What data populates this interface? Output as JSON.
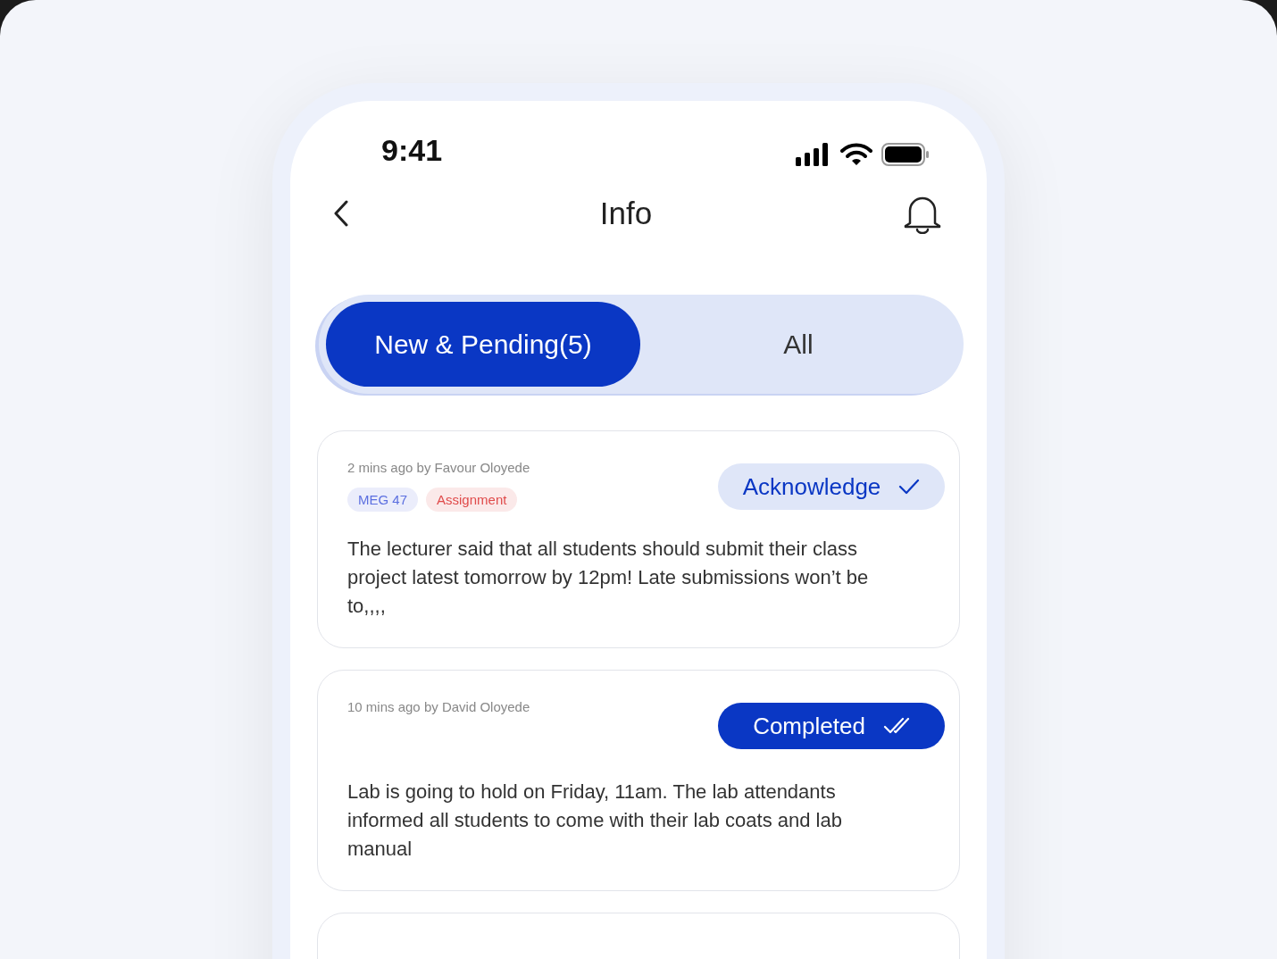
{
  "status_bar": {
    "time": "9:41"
  },
  "header": {
    "title": "Info"
  },
  "tabs": [
    {
      "label": "New & Pending(5)",
      "selected": true
    },
    {
      "label": "All",
      "selected": false
    }
  ],
  "cards": [
    {
      "meta": "2 mins ago by Favour Oloyede",
      "tags": [
        {
          "label": "MEG 47",
          "color": "#5b6fe0"
        },
        {
          "label": "Assignment",
          "color": "#e04b4b"
        }
      ],
      "action": {
        "label": "Acknowledge",
        "kind": "acknowledge"
      },
      "message": "The lecturer said that all students should submit their class project latest tomorrow by 12pm! Late submissions won’t be to,,,,"
    },
    {
      "meta": "10 mins ago by David Oloyede",
      "action": {
        "label": "Completed",
        "kind": "completed"
      },
      "message": "Lab is going to hold on Friday, 11am. The lab attendants informed all students to come with their lab coats and lab manual"
    }
  ]
}
